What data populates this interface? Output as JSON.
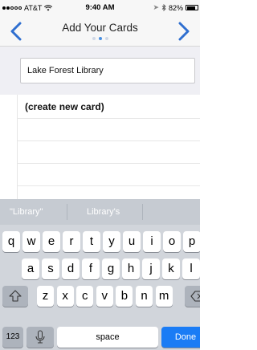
{
  "status_bar": {
    "carrier": "AT&T",
    "time": "9:40 AM",
    "battery": "82%",
    "battery_fill_percent": 82
  },
  "navbar": {
    "title": "Add Your Cards",
    "page_count": 3,
    "active_page": 1
  },
  "search": {
    "value": "Lake Forest Library"
  },
  "list": {
    "items": [
      "(create new card)",
      "",
      "",
      "",
      ""
    ]
  },
  "keyboard": {
    "suggestions": [
      "\"Library\"",
      "Library's",
      ""
    ],
    "row1": [
      "q",
      "w",
      "e",
      "r",
      "t",
      "y",
      "u",
      "i",
      "o",
      "p"
    ],
    "row2": [
      "a",
      "s",
      "d",
      "f",
      "g",
      "h",
      "j",
      "k",
      "l"
    ],
    "row3": [
      "z",
      "x",
      "c",
      "v",
      "b",
      "n",
      "m"
    ],
    "numbers_label": "123",
    "space_label": "space",
    "done_label": "Done"
  },
  "colors": {
    "accent": "#1a7cf5",
    "nav_chevron": "#2f6fd0"
  }
}
